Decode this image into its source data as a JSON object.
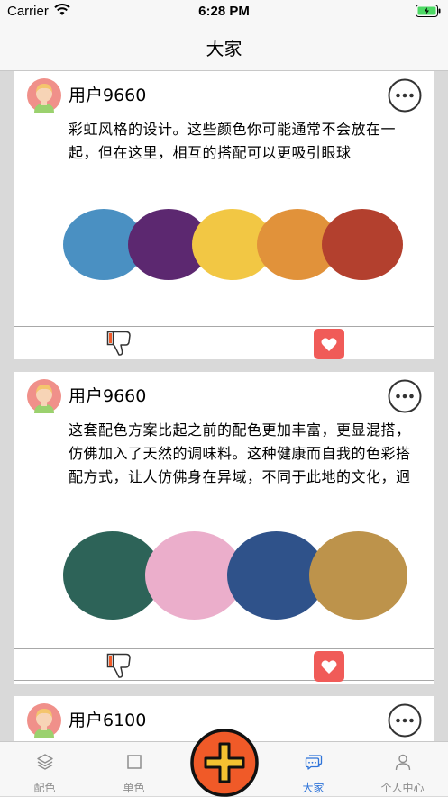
{
  "status_bar": {
    "carrier": "Carrier",
    "time": "6:28 PM"
  },
  "nav": {
    "title": "大家"
  },
  "posts": [
    {
      "username": "用户9660",
      "text": "彩虹风格的设计。这些颜色你可能通常不会放在一起，但在这里，相互的搭配可以更吸引眼球",
      "colors": [
        "#4a90c2",
        "#5c2870",
        "#f2c744",
        "#e1923a",
        "#b3402e"
      ]
    },
    {
      "username": "用户9660",
      "text": "这套配色方案比起之前的配色更加丰富，更显混搭，仿佛加入了天然的调味料。这种健康而自我的色彩搭配方式，让人仿佛身在异域，不同于此地的文化，迥异与此时的感...",
      "colors": [
        "#2d6358",
        "#ebaecb",
        "#2f528a",
        "#bd934b"
      ]
    },
    {
      "username": "用户6100"
    }
  ],
  "tabs": [
    {
      "label": "配色",
      "icon": "layers-icon"
    },
    {
      "label": "单色",
      "icon": "square-icon"
    },
    {
      "label": "",
      "icon": "add-icon"
    },
    {
      "label": "大家",
      "icon": "chat-icon"
    },
    {
      "label": "个人中心",
      "icon": "person-icon"
    }
  ],
  "theme": {
    "active_tab": "#2f74d9",
    "add_button": "#f05a28",
    "heart": "#f05b58"
  }
}
